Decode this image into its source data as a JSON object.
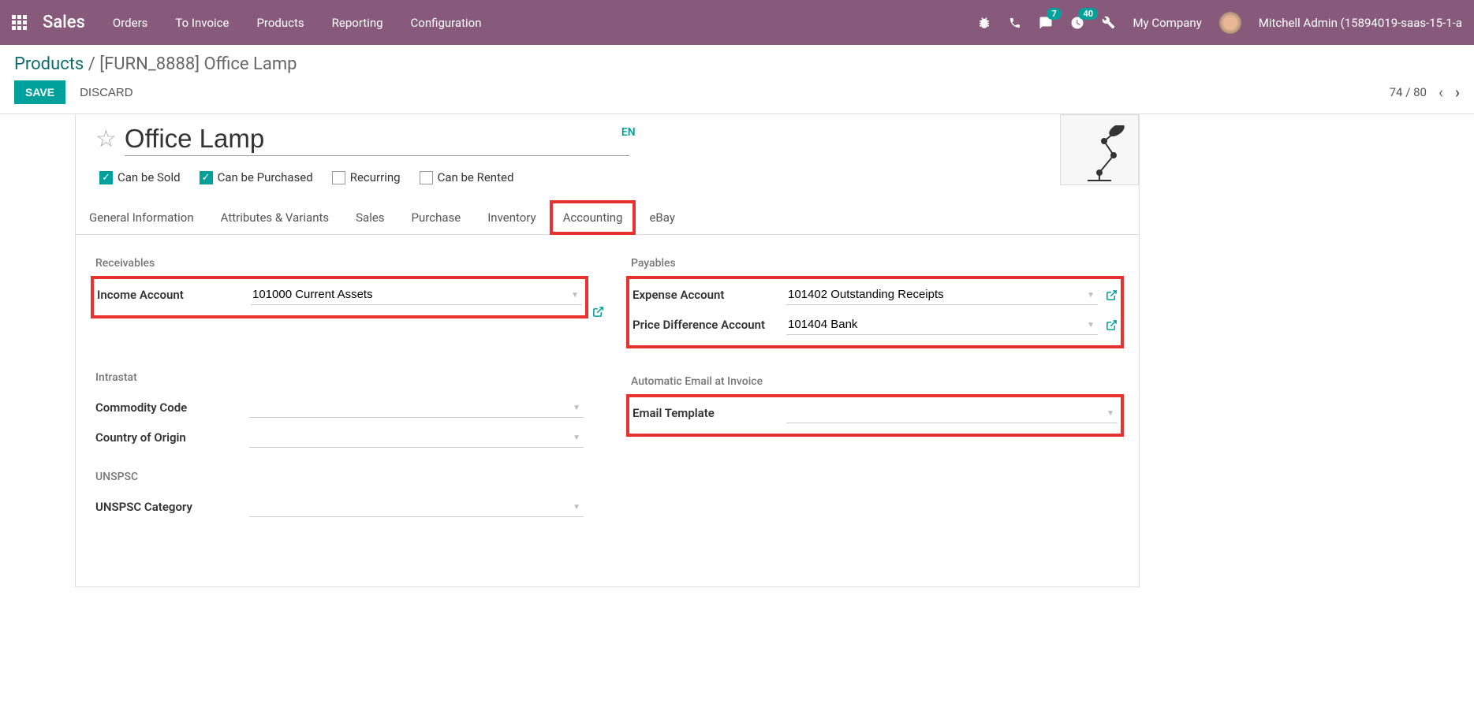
{
  "topbar": {
    "app_title": "Sales",
    "menu": [
      "Orders",
      "To Invoice",
      "Products",
      "Reporting",
      "Configuration"
    ],
    "msg_badge": "7",
    "activity_badge": "40",
    "company": "My Company",
    "user": "Mitchell Admin (15894019-saas-15-1-a"
  },
  "breadcrumb": {
    "parent": "Products",
    "current": "[FURN_8888] Office Lamp"
  },
  "actions": {
    "save": "SAVE",
    "discard": "DISCARD"
  },
  "pager": {
    "text": "74 / 80"
  },
  "form": {
    "name": "Office Lamp",
    "lang": "EN",
    "checks": {
      "sold": "Can be Sold",
      "purchased": "Can be Purchased",
      "recurring": "Recurring",
      "rented": "Can be Rented"
    },
    "tabs": [
      "General Information",
      "Attributes & Variants",
      "Sales",
      "Purchase",
      "Inventory",
      "Accounting",
      "eBay"
    ]
  },
  "sections": {
    "receivables": {
      "title": "Receivables",
      "income_account_label": "Income Account",
      "income_account_value": "101000 Current Assets"
    },
    "payables": {
      "title": "Payables",
      "expense_account_label": "Expense Account",
      "expense_account_value": "101402 Outstanding Receipts",
      "price_diff_label": "Price Difference Account",
      "price_diff_value": "101404 Bank"
    },
    "intrastat": {
      "title": "Intrastat",
      "commodity_label": "Commodity Code",
      "country_label": "Country of Origin"
    },
    "unspsc": {
      "title": "UNSPSC",
      "category_label": "UNSPSC Category"
    },
    "email": {
      "title": "Automatic Email at Invoice",
      "template_label": "Email Template"
    }
  }
}
